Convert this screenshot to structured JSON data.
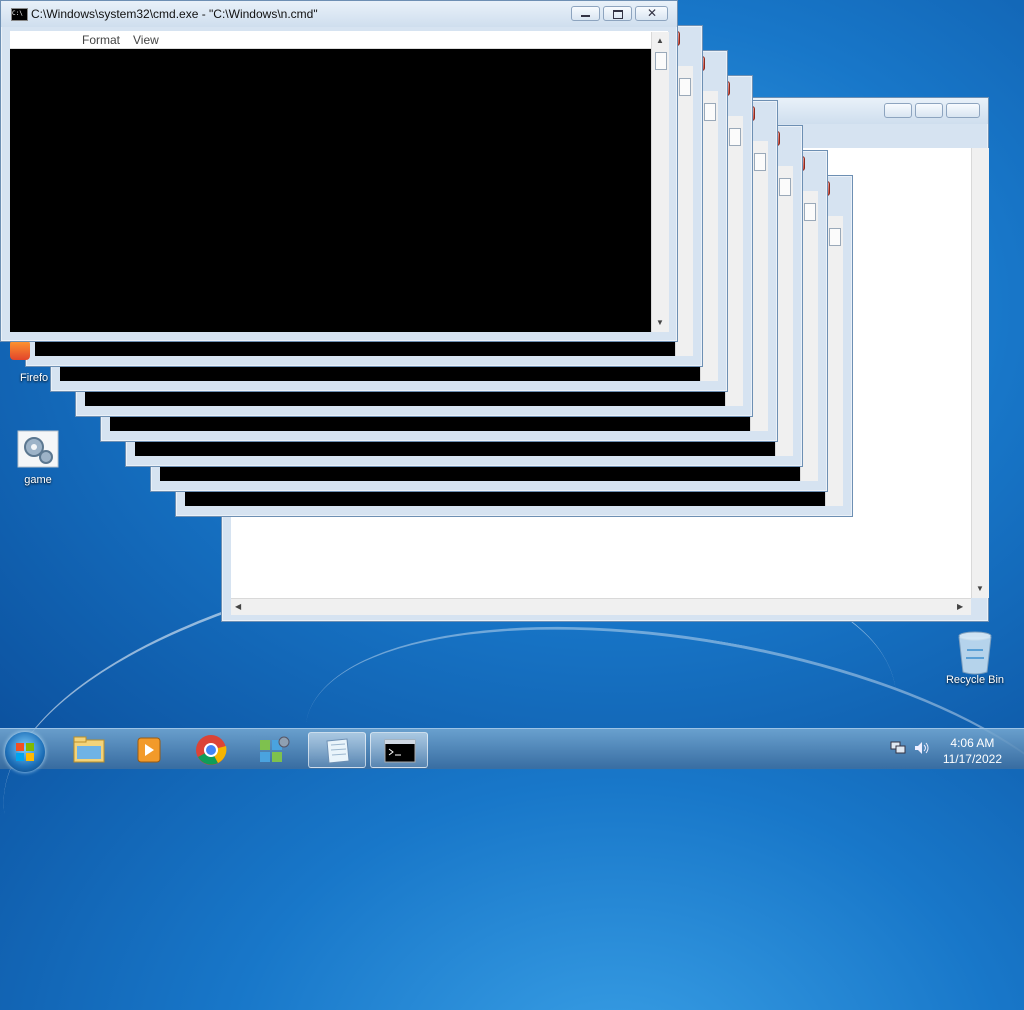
{
  "front_window": {
    "title": "C:\\Windows\\system32\\cmd.exe - \"C:\\Windows\\n.cmd\"",
    "menu": [
      "Format",
      "View"
    ]
  },
  "desktop_icons": [
    {
      "label": "Firefo"
    },
    {
      "label": "game"
    },
    {
      "label": "Recycle Bin"
    }
  ],
  "taskbar": {
    "time": "4:06 AM",
    "date": "11/17/2022"
  },
  "icons": {
    "start": "windows-start-orb",
    "explorer": "folder-icon",
    "media": "media-player-icon",
    "chrome": "chrome-icon",
    "puzzle": "game-app-icon",
    "notepad": "notepad-icon",
    "cmd": "command-prompt-icon",
    "network": "network-icon",
    "volume": "volume-icon",
    "recycle": "recycle-bin-icon"
  },
  "colors": {
    "desktop": "#1877c9",
    "window_frame": "#d6e3f1",
    "console_bg": "#000000"
  }
}
